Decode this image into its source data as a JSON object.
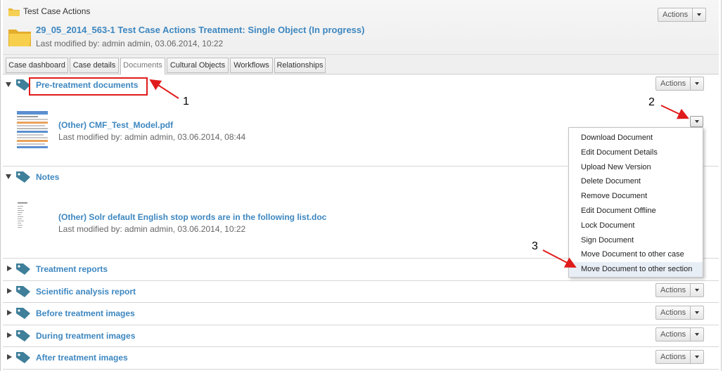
{
  "header": {
    "breadcrumb": "Test Case Actions",
    "case_title": "29_05_2014_563-1 Test Case Actions Treatment: Single Object (In progress)",
    "last_modified": "Last modified by: admin admin, 03.06.2014, 10:22",
    "actions_label": "Actions"
  },
  "tabs": [
    {
      "label": "Case dashboard"
    },
    {
      "label": "Case details"
    },
    {
      "label": "Documents",
      "active": true
    },
    {
      "label": "Cultural Objects"
    },
    {
      "label": "Workflows"
    },
    {
      "label": "Relationships"
    }
  ],
  "sections": [
    {
      "label": "Pre-treatment documents",
      "expanded": true,
      "actions_label": "Actions",
      "document": {
        "title": "(Other) CMF_Test_Model.pdf",
        "meta": "Last modified by: admin admin, 03.06.2014, 08:44"
      }
    },
    {
      "label": "Notes",
      "expanded": true,
      "document": {
        "title": "(Other) Solr default English stop words are in the following list.doc",
        "meta": "Last modified by: admin admin, 03.06.2014, 10:22"
      }
    },
    {
      "label": "Treatment reports",
      "expanded": false
    },
    {
      "label": "Scientific analysis report",
      "expanded": false,
      "actions_label": "Actions"
    },
    {
      "label": "Before treatment images",
      "expanded": false,
      "actions_label": "Actions"
    },
    {
      "label": "During treatment images",
      "expanded": false,
      "actions_label": "Actions"
    },
    {
      "label": "After treatment images",
      "expanded": false,
      "actions_label": "Actions"
    }
  ],
  "document_menu": {
    "items": [
      "Download Document",
      "Edit Document Details",
      "Upload New Version",
      "Delete Document",
      "Remove Document",
      "Edit Document Offline",
      "Lock Document",
      "Sign Document",
      "Move Document to other case",
      "Move Document to other section"
    ],
    "highlighted_index": 9
  },
  "annotations": {
    "callout_1": "1",
    "callout_2": "2",
    "callout_3": "3",
    "color": "#e01b1b"
  },
  "colors": {
    "link": "#3d87c0",
    "tag_icon": "#3f7f9a",
    "folder": "#f0c040"
  }
}
